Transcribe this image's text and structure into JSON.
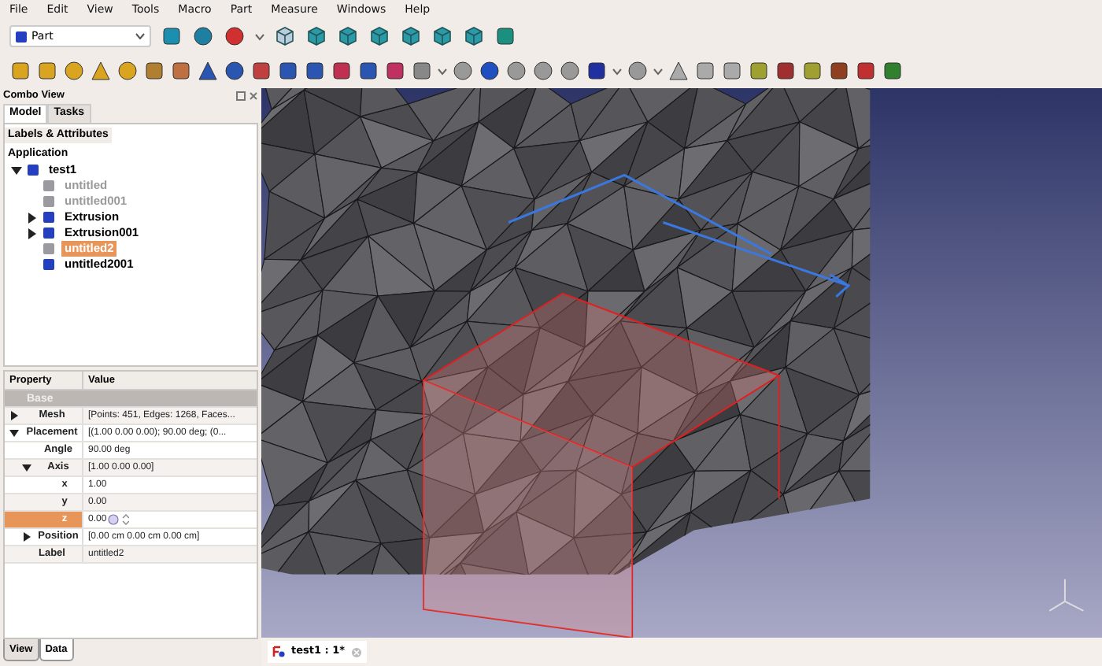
{
  "menu": [
    "File",
    "Edit",
    "View",
    "Tools",
    "Macro",
    "Part",
    "Measure",
    "Windows",
    "Help"
  ],
  "workbench": {
    "value": "Part"
  },
  "combo_view": {
    "title": "Combo View",
    "tabs": [
      {
        "label": "Model",
        "selected": true
      },
      {
        "label": "Tasks",
        "selected": false
      }
    ]
  },
  "tree": {
    "header": "Labels & Attributes",
    "root": "Application",
    "items": [
      {
        "label": "test1",
        "expanded": true,
        "hidden": false,
        "selected": false,
        "children": [
          {
            "label": "untitled",
            "hidden": true,
            "selected": false
          },
          {
            "label": "untitled001",
            "hidden": true,
            "selected": false
          },
          {
            "label": "Extrusion",
            "expanded": false,
            "hidden": false,
            "selected": false
          },
          {
            "label": "Extrusion001",
            "expanded": false,
            "hidden": false,
            "selected": false
          },
          {
            "label": "untitled2",
            "hidden": true,
            "selected": true
          },
          {
            "label": "untitled2001",
            "hidden": false,
            "selected": false
          }
        ]
      }
    ]
  },
  "properties": {
    "columns": [
      "Property",
      "Value"
    ],
    "rows": [
      {
        "kind": "group",
        "name": "Base"
      },
      {
        "kind": "prop",
        "name": "Mesh",
        "value": "[Points: 451, Edges: 1268, Faces...",
        "expanded": false,
        "selected": false
      },
      {
        "kind": "prop",
        "name": "Placement",
        "value": "[(1.00 0.00 0.00); 90.00 deg; (0...",
        "expanded": true,
        "selected": false,
        "children": [
          {
            "kind": "prop",
            "name": "Angle",
            "value": "90.00 deg",
            "selected": false
          },
          {
            "kind": "prop",
            "name": "Axis",
            "value": "[1.00 0.00 0.00]",
            "expanded": true,
            "selected": false,
            "children": [
              {
                "kind": "prop",
                "name": "x",
                "value": "1.00",
                "selected": false
              },
              {
                "kind": "prop",
                "name": "y",
                "value": "0.00",
                "selected": false
              },
              {
                "kind": "prop",
                "name": "z",
                "value": "0.00",
                "selected": true
              }
            ]
          },
          {
            "kind": "prop",
            "name": "Position",
            "value": "[0.00 cm  0.00 cm  0.00 cm]",
            "expanded": false,
            "selected": false
          }
        ]
      },
      {
        "kind": "prop",
        "name": "Label",
        "value": "untitled2",
        "selected": false
      }
    ],
    "tabs": [
      {
        "label": "View",
        "selected": false
      },
      {
        "label": "Data",
        "selected": true
      }
    ]
  },
  "document_tabs": [
    {
      "label": "test1 : 1*",
      "selected": true
    }
  ]
}
